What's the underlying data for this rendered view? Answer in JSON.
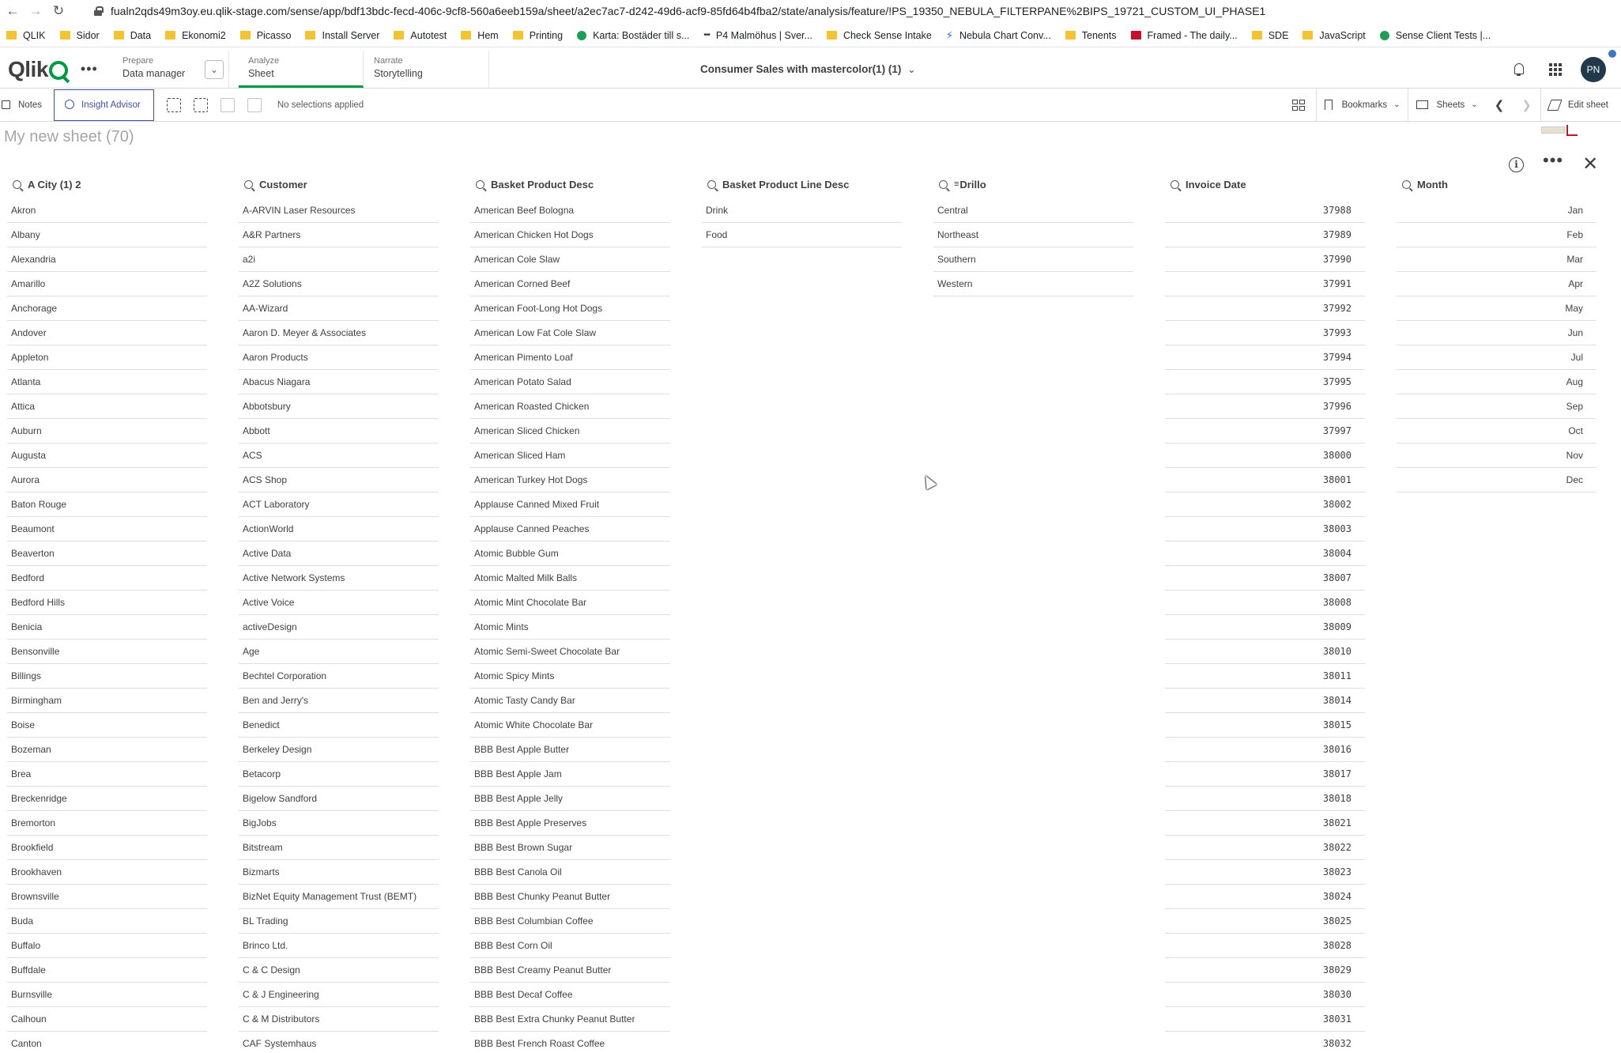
{
  "browser": {
    "url": "fualn2qds49m3oy.eu.qlik-stage.com/sense/app/bdf13bdc-fecd-406c-9cf8-560a6eeb159a/sheet/a2ec7ac7-d242-49d6-acf9-85fd64b4fba2/state/analysis/feature/!PS_19350_NEBULA_FILTERPANE%2BIPS_19721_CUSTOM_UI_PHASE1"
  },
  "bookmarks": [
    {
      "label": "QLIK",
      "icon": "folder-icon"
    },
    {
      "label": "Sidor",
      "icon": "folder-icon"
    },
    {
      "label": "Data",
      "icon": "folder-icon"
    },
    {
      "label": "Ekonomi2",
      "icon": "folder-icon"
    },
    {
      "label": "Picasso",
      "icon": "folder-icon"
    },
    {
      "label": "Install Server",
      "icon": "folder-icon"
    },
    {
      "label": "Autotest",
      "icon": "folder-icon"
    },
    {
      "label": "Hem",
      "icon": "folder-icon"
    },
    {
      "label": "Printing",
      "icon": "folder-icon"
    },
    {
      "label": "Karta: Bostäder till s...",
      "icon": "globe-icon"
    },
    {
      "label": "P4 Malmöhus | Sver...",
      "icon": "radio-icon"
    },
    {
      "label": "Check Sense Intake",
      "icon": "folder-icon"
    },
    {
      "label": "Nebula Chart Conv...",
      "icon": "bolt-icon"
    },
    {
      "label": "Tenents",
      "icon": "folder-icon"
    },
    {
      "label": "Framed - The daily...",
      "icon": "framed-icon"
    },
    {
      "label": "SDE",
      "icon": "folder-icon"
    },
    {
      "label": "JavaScript",
      "icon": "folder-icon"
    },
    {
      "label": "Sense Client Tests |...",
      "icon": "globe-icon"
    }
  ],
  "header": {
    "logo": "Qlik",
    "prepare": {
      "small": "Prepare",
      "big": "Data manager"
    },
    "analyze": {
      "small": "Analyze",
      "big": "Sheet"
    },
    "narrate": {
      "small": "Narrate",
      "big": "Storytelling"
    },
    "app_title": "Consumer Sales with mastercolor(1) (1)",
    "avatar": "PN"
  },
  "toolbar": {
    "notes": "Notes",
    "insight_advisor": "Insight Advisor",
    "no_selections": "No selections applied",
    "bookmarks": "Bookmarks",
    "sheets": "Sheets",
    "edit_sheet": "Edit sheet"
  },
  "sheet": {
    "title": "My new sheet (70)"
  },
  "colors": {
    "qlik_green": "#009845",
    "insight_blue": "#3d52a0",
    "avatar_bg": "#22394a"
  },
  "listboxes": [
    {
      "title": "A City (1) 2",
      "align": "left",
      "items": [
        "Akron",
        "Albany",
        "Alexandria",
        "Amarillo",
        "Anchorage",
        "Andover",
        "Appleton",
        "Atlanta",
        "Attica",
        "Auburn",
        "Augusta",
        "Aurora",
        "Baton Rouge",
        "Beaumont",
        "Beaverton",
        "Bedford",
        "Bedford Hills",
        "Benicia",
        "Bensonville",
        "Billings",
        "Birmingham",
        "Boise",
        "Bozeman",
        "Brea",
        "Breckenridge",
        "Bremorton",
        "Brookfield",
        "Brookhaven",
        "Brownsville",
        "Buda",
        "Buffalo",
        "Buffdale",
        "Burnsville",
        "Calhoun",
        "Canton"
      ]
    },
    {
      "title": "Customer",
      "align": "left",
      "items": [
        "A-ARVIN Laser Resources",
        "A&R Partners",
        "a2i",
        "A2Z Solutions",
        "AA-Wizard",
        "Aaron D. Meyer & Associates",
        "Aaron Products",
        "Abacus Niagara",
        "Abbotsbury",
        "Abbott",
        "ACS",
        "ACS Shop",
        "ACT Laboratory",
        "ActionWorld",
        "Active Data",
        "Active Network Systems",
        "Active Voice",
        "activeDesign",
        "Age",
        "Bechtel Corporation",
        "Ben and Jerry's",
        "Benedict",
        "Berkeley Design",
        "Betacorp",
        "Bigelow Sandford",
        "BigJobs",
        "Bitstream",
        "Bizmarts",
        "BizNet Equity Management Trust (BEMT)",
        "BL Trading",
        "Brinco Ltd.",
        "C & C Design",
        "C & J Engineering",
        "C & M Distributors",
        "CAF Systemhaus"
      ]
    },
    {
      "title": "Basket Product Desc",
      "align": "left",
      "items": [
        "American Beef Bologna",
        "American Chicken Hot Dogs",
        "American Cole Slaw",
        "American Corned Beef",
        "American Foot-Long Hot Dogs",
        "American Low Fat Cole Slaw",
        "American Pimento Loaf",
        "American Potato Salad",
        "American Roasted Chicken",
        "American Sliced Chicken",
        "American Sliced Ham",
        "American Turkey Hot Dogs",
        "Applause Canned Mixed Fruit",
        "Applause Canned Peaches",
        "Atomic Bubble Gum",
        "Atomic Malted Milk Balls",
        "Atomic Mint Chocolate Bar",
        "Atomic Mints",
        "Atomic Semi-Sweet Chocolate Bar",
        "Atomic Spicy Mints",
        "Atomic Tasty Candy Bar",
        "Atomic White Chocolate Bar",
        "BBB Best Apple Butter",
        "BBB Best Apple Jam",
        "BBB Best Apple Jelly",
        "BBB Best Apple Preserves",
        "BBB Best Brown Sugar",
        "BBB Best Canola Oil",
        "BBB Best Chunky Peanut Butter",
        "BBB Best Columbian Coffee",
        "BBB Best Corn Oil",
        "BBB Best Creamy Peanut Butter",
        "BBB Best Decaf Coffee",
        "BBB Best Extra Chunky Peanut Butter",
        "BBB Best French Roast Coffee"
      ]
    },
    {
      "title": "Basket Product Line Desc",
      "align": "left",
      "items": [
        "Drink",
        "Food"
      ]
    },
    {
      "title": "Drillo",
      "align": "left",
      "drill": true,
      "items": [
        "Central",
        "Northeast",
        "Southern",
        "Western"
      ]
    },
    {
      "title": "Invoice Date",
      "align": "right",
      "items": [
        "37988",
        "37989",
        "37990",
        "37991",
        "37992",
        "37993",
        "37994",
        "37995",
        "37996",
        "37997",
        "38000",
        "38001",
        "38002",
        "38003",
        "38004",
        "38007",
        "38008",
        "38009",
        "38010",
        "38011",
        "38014",
        "38015",
        "38016",
        "38017",
        "38018",
        "38021",
        "38022",
        "38023",
        "38024",
        "38025",
        "38028",
        "38029",
        "38030",
        "38031",
        "38032"
      ]
    },
    {
      "title": "Month",
      "align": "right-txt",
      "items": [
        "Jan",
        "Feb",
        "Mar",
        "Apr",
        "May",
        "Jun",
        "Jul",
        "Aug",
        "Sep",
        "Oct",
        "Nov",
        "Dec"
      ]
    }
  ]
}
